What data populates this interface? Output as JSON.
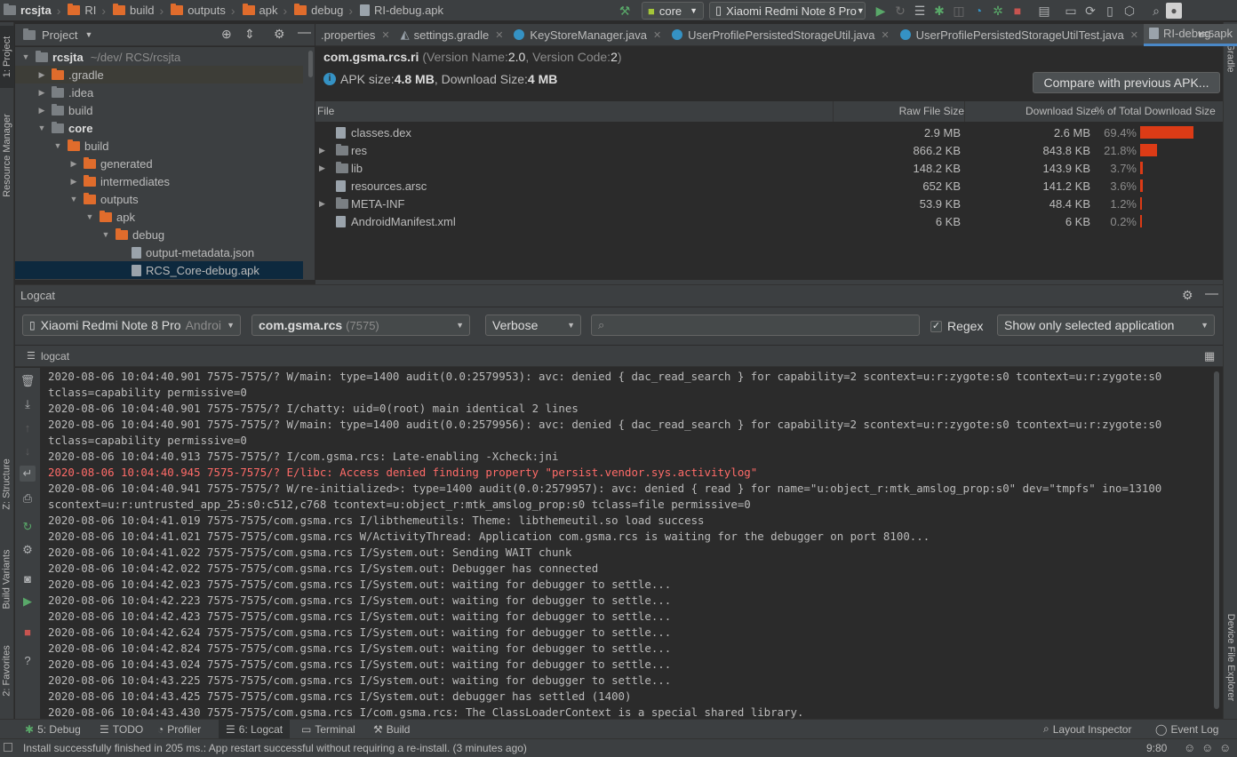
{
  "navbar": {
    "crumbs": [
      "rcsjta",
      "RI",
      "build",
      "outputs",
      "apk",
      "debug",
      "RI-debug.apk"
    ],
    "run_config": "core",
    "device": "Xiaomi Redmi Note 8 Pro"
  },
  "left_stripe": {
    "project": "1: Project",
    "resource_manager": "Resource Manager",
    "structure": "Z: Structure",
    "build_variants": "Build Variants",
    "favorites": "2: Favorites"
  },
  "right_stripe": {
    "gradle": "Gradle",
    "device_file_explorer": "Device File Explorer"
  },
  "project_panel": {
    "title": "Project",
    "tree": [
      {
        "label": "rcsjta",
        "extra": "~/dev/        RCS/rcsjta",
        "level": 0,
        "expanded": true,
        "bold": true,
        "icon": "folder-gray"
      },
      {
        "label": ".gradle",
        "level": 1,
        "expanded": false,
        "icon": "folder"
      },
      {
        "label": ".idea",
        "level": 1,
        "expanded": false,
        "icon": "folder-gray"
      },
      {
        "label": "build",
        "level": 1,
        "expanded": false,
        "icon": "folder-gray"
      },
      {
        "label": "core",
        "level": 1,
        "expanded": true,
        "bold": true,
        "icon": "folder-gray"
      },
      {
        "label": "build",
        "level": 2,
        "expanded": true,
        "icon": "folder"
      },
      {
        "label": "generated",
        "level": 3,
        "expanded": false,
        "icon": "folder"
      },
      {
        "label": "intermediates",
        "level": 3,
        "expanded": false,
        "icon": "folder"
      },
      {
        "label": "outputs",
        "level": 3,
        "expanded": true,
        "icon": "folder"
      },
      {
        "label": "apk",
        "level": 4,
        "expanded": true,
        "icon": "folder"
      },
      {
        "label": "debug",
        "level": 5,
        "expanded": true,
        "icon": "folder"
      },
      {
        "label": "output-metadata.json",
        "level": 6,
        "icon": "file"
      },
      {
        "label": "RCS_Core-debug.apk",
        "level": 6,
        "icon": "file",
        "selected": true
      }
    ]
  },
  "editor_tabs": [
    {
      "label": ".properties",
      "active": false
    },
    {
      "label": "settings.gradle",
      "active": false
    },
    {
      "label": "KeyStoreManager.java",
      "active": false
    },
    {
      "label": "UserProfilePersistedStorageUtil.java",
      "active": false
    },
    {
      "label": "UserProfilePersistedStorageUtilTest.java",
      "active": false
    },
    {
      "label": "RI-debug.apk",
      "active": true
    }
  ],
  "tabs_overflow": "5",
  "apk": {
    "package": "com.gsma.rcs.ri",
    "version_prefix": "(Version Name: ",
    "version_name": "2.0",
    "version_mid": ", Version Code: ",
    "version_code": "2",
    "version_suffix": ")",
    "size_prefix": "APK size: ",
    "apk_size": "4.8 MB",
    "download_prefix": ", Download Size: ",
    "download_size": "4 MB",
    "compare_button": "Compare with previous APK...",
    "columns": [
      "File",
      "Raw File Size",
      "Download Size",
      "% of Total Download Size"
    ],
    "files": [
      {
        "name": "classes.dex",
        "raw": "2.9 MB",
        "download": "2.6 MB",
        "pct": "69.4%",
        "pct_value": 69.4,
        "expandable": false
      },
      {
        "name": "res",
        "raw": "866.2 KB",
        "download": "843.8 KB",
        "pct": "21.8%",
        "pct_value": 21.8,
        "expandable": true
      },
      {
        "name": "lib",
        "raw": "148.2 KB",
        "download": "143.9 KB",
        "pct": "3.7%",
        "pct_value": 3.7,
        "expandable": true
      },
      {
        "name": "resources.arsc",
        "raw": "652 KB",
        "download": "141.2 KB",
        "pct": "3.6%",
        "pct_value": 3.6,
        "expandable": false
      },
      {
        "name": "META-INF",
        "raw": "53.9 KB",
        "download": "48.4 KB",
        "pct": "1.2%",
        "pct_value": 1.2,
        "expandable": true
      },
      {
        "name": "AndroidManifest.xml",
        "raw": "6 KB",
        "download": "6 KB",
        "pct": "0.2%",
        "pct_value": 0.2,
        "expandable": false
      }
    ]
  },
  "logcat": {
    "title": "Logcat",
    "device": "Xiaomi Redmi Note 8 Pro",
    "device_suffix": "Androi",
    "process": "com.gsma.rcs",
    "process_pid": "(7575)",
    "level": "Verbose",
    "search_placeholder": "",
    "regex_label": "Regex",
    "filter": "Show only selected application",
    "tab": "logcat",
    "lines": [
      {
        "text": "2020-08-06 10:04:40.901 7575-7575/? W/main: type=1400 audit(0.0:2579953): avc: denied { dac_read_search } for capability=2 scontext=u:r:zygote:s0 tcontext=u:r:zygote:s0",
        "level": "W"
      },
      {
        "text": "  tclass=capability permissive=0",
        "level": "W"
      },
      {
        "text": "2020-08-06 10:04:40.901 7575-7575/? I/chatty: uid=0(root) main identical 2 lines",
        "level": "I"
      },
      {
        "text": "2020-08-06 10:04:40.901 7575-7575/? W/main: type=1400 audit(0.0:2579956): avc: denied { dac_read_search } for capability=2 scontext=u:r:zygote:s0 tcontext=u:r:zygote:s0",
        "level": "W"
      },
      {
        "text": "  tclass=capability permissive=0",
        "level": "W"
      },
      {
        "text": "2020-08-06 10:04:40.913 7575-7575/? I/com.gsma.rcs: Late-enabling -Xcheck:jni",
        "level": "I"
      },
      {
        "text": "2020-08-06 10:04:40.945 7575-7575/? E/libc: Access denied finding property \"persist.vendor.sys.activitylog\"",
        "level": "E"
      },
      {
        "text": "2020-08-06 10:04:40.941 7575-7575/? W/re-initialized>: type=1400 audit(0.0:2579957): avc: denied { read } for name=\"u:object_r:mtk_amslog_prop:s0\" dev=\"tmpfs\" ino=13100",
        "level": "W"
      },
      {
        "text": "  scontext=u:r:untrusted_app_25:s0:c512,c768 tcontext=u:object_r:mtk_amslog_prop:s0 tclass=file permissive=0",
        "level": "W"
      },
      {
        "text": "2020-08-06 10:04:41.019 7575-7575/com.gsma.rcs I/libthemeutils: Theme:  libthemeutil.so load success",
        "level": "I"
      },
      {
        "text": "2020-08-06 10:04:41.021 7575-7575/com.gsma.rcs W/ActivityThread: Application com.gsma.rcs is waiting for the debugger on port 8100...",
        "level": "W"
      },
      {
        "text": "2020-08-06 10:04:41.022 7575-7575/com.gsma.rcs I/System.out: Sending WAIT chunk",
        "level": "I"
      },
      {
        "text": "2020-08-06 10:04:42.022 7575-7575/com.gsma.rcs I/System.out: Debugger has connected",
        "level": "I"
      },
      {
        "text": "2020-08-06 10:04:42.023 7575-7575/com.gsma.rcs I/System.out: waiting for debugger to settle...",
        "level": "I"
      },
      {
        "text": "2020-08-06 10:04:42.223 7575-7575/com.gsma.rcs I/System.out: waiting for debugger to settle...",
        "level": "I"
      },
      {
        "text": "2020-08-06 10:04:42.423 7575-7575/com.gsma.rcs I/System.out: waiting for debugger to settle...",
        "level": "I"
      },
      {
        "text": "2020-08-06 10:04:42.624 7575-7575/com.gsma.rcs I/System.out: waiting for debugger to settle...",
        "level": "I"
      },
      {
        "text": "2020-08-06 10:04:42.824 7575-7575/com.gsma.rcs I/System.out: waiting for debugger to settle...",
        "level": "I"
      },
      {
        "text": "2020-08-06 10:04:43.024 7575-7575/com.gsma.rcs I/System.out: waiting for debugger to settle...",
        "level": "I"
      },
      {
        "text": "2020-08-06 10:04:43.225 7575-7575/com.gsma.rcs I/System.out: waiting for debugger to settle...",
        "level": "I"
      },
      {
        "text": "2020-08-06 10:04:43.425 7575-7575/com.gsma.rcs I/System.out: debugger has settled (1400)",
        "level": "I"
      },
      {
        "text": "2020-08-06 10:04:43.430 7575-7575/com.gsma.rcs I/com.gsma.rcs: The ClassLoaderContext is a special shared library.",
        "level": "I"
      }
    ]
  },
  "bottom_tabs": [
    {
      "label": "5: Debug",
      "active": false
    },
    {
      "label": "TODO",
      "active": false
    },
    {
      "label": "Profiler",
      "active": false
    },
    {
      "label": "6: Logcat",
      "active": true
    },
    {
      "label": "Terminal",
      "active": false
    },
    {
      "label": "Build",
      "active": false
    }
  ],
  "bottom_right_tabs": [
    "Layout Inspector",
    "Event Log"
  ],
  "status": {
    "message": "Install successfully finished in 205 ms.: App restart successful without requiring a re-install. (3 minutes ago)",
    "position": "9:80"
  },
  "colors": {
    "accent": "#4a88c7",
    "bar": "#dc3b16",
    "error": "#ff6b68",
    "run_green": "#59a869",
    "stop_red": "#c75450"
  }
}
